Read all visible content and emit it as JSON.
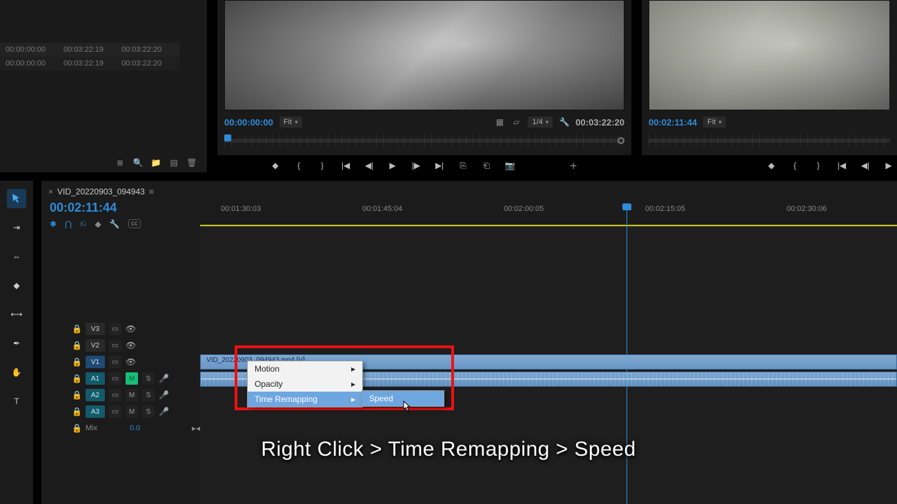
{
  "project": {
    "columns": [
      "00:00:00:00",
      "00:03:22:19",
      "00:03:22:20"
    ],
    "rows": [
      [
        "00:00:00:00",
        "00:03:22:19",
        "00:03:22:20"
      ]
    ]
  },
  "source_monitor": {
    "timecode_in": "00:00:00:00",
    "fit_label": "Fit",
    "res_label": "1/4",
    "duration": "00:03:22:20"
  },
  "program_monitor": {
    "timecode": "00:02:11:44",
    "fit_label": "Fit"
  },
  "timeline": {
    "sequence_name": "VID_20220903_094943",
    "playhead_time": "00:02:11:44",
    "ruler_ticks": [
      "00:01:30:03",
      "00:01:45:04",
      "00:02:00:05",
      "00:02:15:05",
      "00:02:30:06"
    ],
    "clip_name": "VID_20220903_094943.mp4 [V]",
    "mix_label": "Mix",
    "mix_value": "0.0",
    "tracks": {
      "v3": "V3",
      "v2": "V2",
      "v1": "V1",
      "a1": "A1",
      "a2": "A2",
      "a3": "A3",
      "m": "M",
      "s": "S"
    }
  },
  "context_menu": {
    "items": [
      "Motion",
      "Opacity",
      "Time Remapping"
    ],
    "submenu": [
      "Speed"
    ]
  },
  "caption": "Right Click > Time Remapping > Speed"
}
